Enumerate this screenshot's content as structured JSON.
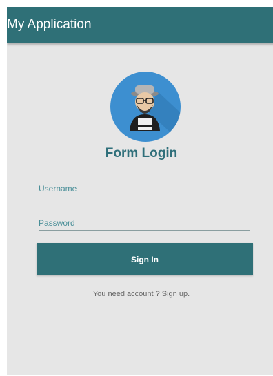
{
  "appbar": {
    "title": "My Application"
  },
  "form": {
    "title": "Form Login",
    "username_placeholder": "Username",
    "password_placeholder": "Password",
    "signin_label": "Sign In",
    "signup_text": "You need account ? Sign up."
  },
  "colors": {
    "primary": "#2f7077",
    "background": "#e6e6e6",
    "avatar_bg": "#3d8fd0"
  },
  "icons": {
    "avatar": "user-avatar-icon"
  }
}
